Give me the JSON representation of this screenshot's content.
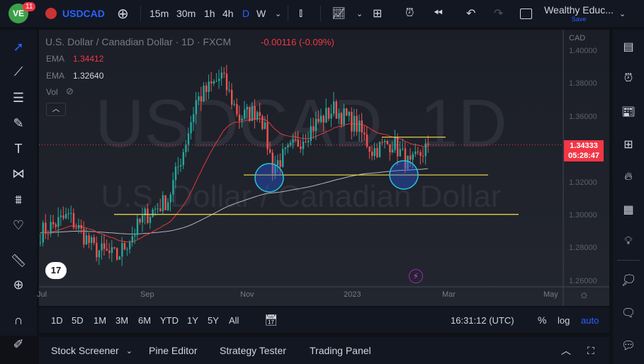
{
  "topbar": {
    "notif_count": "11",
    "symbol": "USDCAD",
    "intervals": [
      "15m",
      "30m",
      "1h",
      "4h",
      "D",
      "W"
    ],
    "active_interval": "D",
    "layout_name": "Wealthy Educ...",
    "save_label": "Save"
  },
  "legend": {
    "title": "U.S. Dollar / Canadian Dollar · 1D · FXCM",
    "change": "-0.00116 (-0.09%)",
    "ema1_label": "EMA",
    "ema1_value": "1.34412",
    "ema2_label": "EMA",
    "ema2_value": "1.32640",
    "vol_label": "Vol"
  },
  "watermark": {
    "symbol": "USDCAD, 1D",
    "name": "U.S. Dollar / Canadian Dollar"
  },
  "price_axis": {
    "currency": "CAD",
    "ticks": [
      "1.40000",
      "1.38000",
      "1.36000",
      "1.34000",
      "1.32000",
      "1.30000",
      "1.28000",
      "1.26000"
    ],
    "current_price": "1.34333",
    "countdown": "05:28:47"
  },
  "time_axis": [
    "Jul",
    "Sep",
    "Nov",
    "2023",
    "Mar",
    "May"
  ],
  "ranges": [
    "1D",
    "5D",
    "1M",
    "3M",
    "6M",
    "YTD",
    "1Y",
    "5Y",
    "All"
  ],
  "clock": "16:31:12 (UTC)",
  "scale_opts": [
    "%",
    "log",
    "auto"
  ],
  "panels": [
    "Stock Screener",
    "Pine Editor",
    "Strategy Tester",
    "Trading Panel"
  ],
  "colors": {
    "up": "#26a69a",
    "down": "#ef5350",
    "ema50": "#e53935",
    "ema200": "#b2b5be",
    "accent": "#2962ff",
    "price": "#f23645"
  },
  "chart_data": {
    "type": "candlestick",
    "anchors": [
      [
        0,
        1.29
      ],
      [
        11,
        1.3
      ],
      [
        21,
        1.28
      ],
      [
        30,
        1.275
      ],
      [
        41,
        1.3
      ],
      [
        50,
        1.31
      ],
      [
        56,
        1.34
      ],
      [
        61,
        1.37
      ],
      [
        71,
        1.385
      ],
      [
        78,
        1.36
      ],
      [
        86,
        1.365
      ],
      [
        91,
        1.33
      ],
      [
        98,
        1.34
      ],
      [
        107,
        1.355
      ],
      [
        115,
        1.365
      ],
      [
        124,
        1.355
      ],
      [
        130,
        1.34
      ],
      [
        138,
        1.345
      ],
      [
        145,
        1.33
      ],
      [
        152,
        1.3433
      ]
    ],
    "support_levels": [
      1.325,
      1.301
    ],
    "resistance": 1.348
  }
}
